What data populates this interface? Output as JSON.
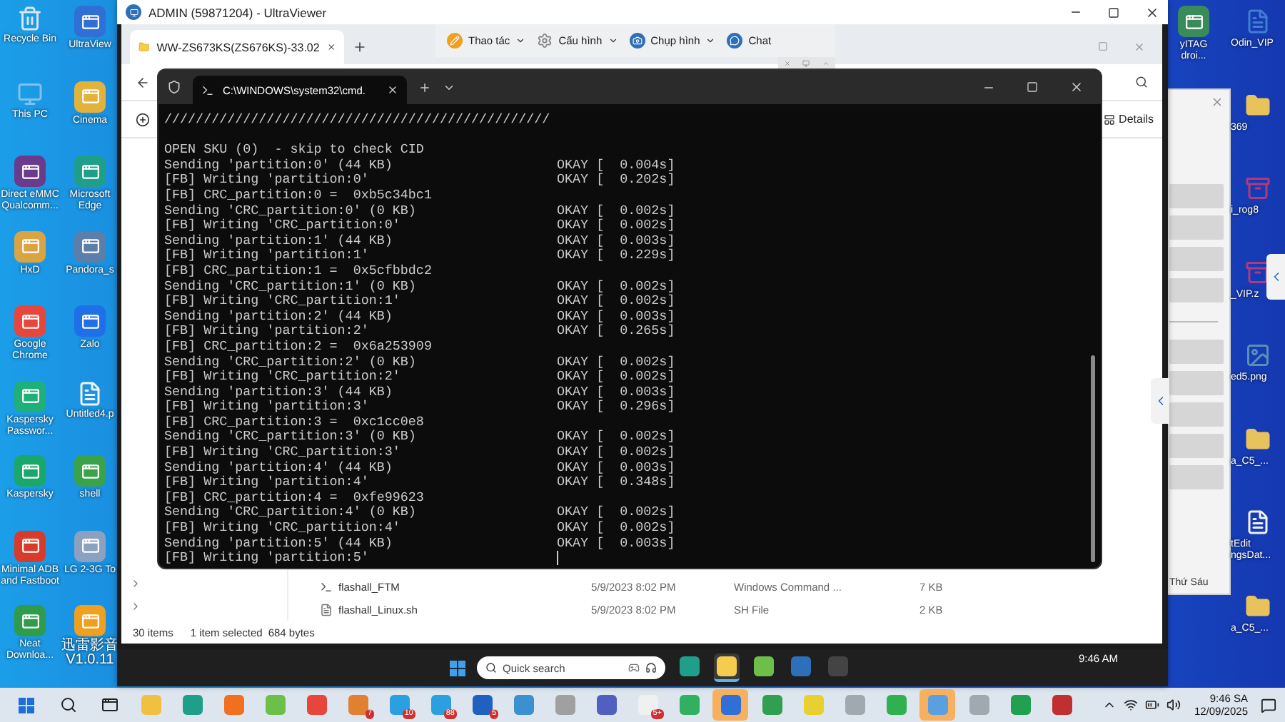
{
  "desktop_left": [
    {
      "label": "Recycle Bin",
      "kind": "recycle",
      "color": "#d8e6f0"
    },
    {
      "label": "UltraView",
      "kind": "app",
      "color": "#2f6fd6"
    },
    {
      "label": "This PC",
      "kind": "computer",
      "color": "#7ec3f0"
    },
    {
      "label": "Cinema",
      "kind": "app",
      "color": "#e2b23a"
    },
    {
      "label": "Direct eMMC Qualcomm...",
      "kind": "app",
      "color": "#6a3b8c"
    },
    {
      "label": "Microsoft Edge",
      "kind": "app",
      "color": "#1f9e8a"
    },
    {
      "label": "HxD",
      "kind": "app",
      "color": "#d9a441"
    },
    {
      "label": "Pandora_s",
      "kind": "app",
      "color": "#5b7fa8"
    },
    {
      "label": "Google Chrome",
      "kind": "app",
      "color": "#e8453c"
    },
    {
      "label": "Zalo",
      "kind": "app",
      "color": "#1e6fe8"
    },
    {
      "label": "Kaspersky Passwor...",
      "kind": "app",
      "color": "#1fb07a"
    },
    {
      "label": "Untitled4.p",
      "kind": "document",
      "color": "#f2f2f2"
    },
    {
      "label": "Kaspersky",
      "kind": "app",
      "color": "#1aa86a"
    },
    {
      "label": "shell",
      "kind": "app",
      "color": "#3aa34a"
    },
    {
      "label": "Minimal ADB and Fastboot",
      "kind": "app",
      "color": "#d93b2b"
    },
    {
      "label": "LG 2-3G To",
      "kind": "app",
      "color": "#8aa1c0"
    },
    {
      "label": "Neat Downloa...",
      "kind": "app",
      "color": "#2e9c4a"
    },
    {
      "label": "迅雷影音 V1.0.11",
      "kind": "app",
      "color": "#f0a020"
    }
  ],
  "desktop_right_partial": {
    "label": "yITAG droi...",
    "kind": "app",
    "color": "#3b8b5a"
  },
  "desktop_right": [
    {
      "label": "Odin_VIP",
      "kind": "document",
      "color": "#3f7fd0"
    },
    {
      "label": "369",
      "kind": "folder",
      "color": "#e8c25a"
    },
    {
      "label": "i_rog8",
      "kind": "archive",
      "color": "#b33a7a"
    },
    {
      "label": "_VIP.z",
      "kind": "archive",
      "color": "#b33a7a"
    },
    {
      "label": "ed5.png",
      "kind": "image",
      "color": "#5a8fb8"
    },
    {
      "label": "a_C5_...",
      "kind": "folder",
      "color": "#e8c25a"
    },
    {
      "label": "tEdit ngsDat...",
      "kind": "document",
      "color": "#f2f2f2"
    },
    {
      "label": "a_C5_...",
      "kind": "folder",
      "color": "#e8c25a"
    }
  ],
  "ultraviewer": {
    "title": "ADMIN (59871204) - UltraViewer",
    "toolbar": [
      {
        "label": "Thao tác",
        "kind": "actions",
        "menu": true
      },
      {
        "label": "Cấu hình",
        "kind": "settings",
        "menu": true
      },
      {
        "label": "Chụp hình",
        "kind": "capture",
        "menu": true
      },
      {
        "label": "Chat",
        "kind": "chat",
        "menu": false
      }
    ]
  },
  "explorer": {
    "tab": "WW-ZS673KS(ZS676KS)-33.02",
    "details_button": "Details",
    "files": [
      {
        "name": "flashall_FTM",
        "date": "5/9/2023 8:02 PM",
        "type": "Windows Command ...",
        "size": "7 KB",
        "kind": "script"
      },
      {
        "name": "flashall_Linux.sh",
        "date": "5/9/2023 8:02 PM",
        "type": "SH File",
        "size": "2 KB",
        "kind": "file"
      }
    ],
    "status": {
      "count": "30 items",
      "selection": "1 item selected",
      "size": "684 bytes"
    }
  },
  "terminal": {
    "tab": "C:\\WINDOWS\\system32\\cmd.",
    "lines": [
      {
        "text": "/////////////////////////////////////////////////"
      },
      {
        "text": "OPEN SKU (0)  - skip to check CID",
        "gap_before": true
      },
      {
        "text": "Sending 'partition:0' (44 KB)",
        "result": "OKAY [  0.004s]"
      },
      {
        "text": "[FB] Writing 'partition:0'",
        "result": "OKAY [  0.202s]"
      },
      {
        "text": "[FB] CRC_partition:0 =  0xb5c34bc1"
      },
      {
        "text": "Sending 'CRC_partition:0' (0 KB)",
        "result": "OKAY [  0.002s]"
      },
      {
        "text": "[FB] Writing 'CRC_partition:0'",
        "result": "OKAY [  0.002s]"
      },
      {
        "text": "Sending 'partition:1' (44 KB)",
        "result": "OKAY [  0.003s]"
      },
      {
        "text": "[FB] Writing 'partition:1'",
        "result": "OKAY [  0.229s]"
      },
      {
        "text": "[FB] CRC_partition:1 =  0x5cfbbdc2"
      },
      {
        "text": "Sending 'CRC_partition:1' (0 KB)",
        "result": "OKAY [  0.002s]"
      },
      {
        "text": "[FB] Writing 'CRC_partition:1'",
        "result": "OKAY [  0.002s]"
      },
      {
        "text": "Sending 'partition:2' (44 KB)",
        "result": "OKAY [  0.003s]"
      },
      {
        "text": "[FB] Writing 'partition:2'",
        "result": "OKAY [  0.265s]"
      },
      {
        "text": "[FB] CRC_partition:2 =  0x6a253909"
      },
      {
        "text": "Sending 'CRC_partition:2' (0 KB)",
        "result": "OKAY [  0.002s]"
      },
      {
        "text": "[FB] Writing 'CRC_partition:2'",
        "result": "OKAY [  0.002s]"
      },
      {
        "text": "Sending 'partition:3' (44 KB)",
        "result": "OKAY [  0.003s]"
      },
      {
        "text": "[FB] Writing 'partition:3'",
        "result": "OKAY [  0.296s]"
      },
      {
        "text": "[FB] CRC_partition:3 =  0xc1cc0e8"
      },
      {
        "text": "Sending 'CRC_partition:3' (0 KB)",
        "result": "OKAY [  0.002s]"
      },
      {
        "text": "[FB] Writing 'CRC_partition:3'",
        "result": "OKAY [  0.002s]"
      },
      {
        "text": "Sending 'partition:4' (44 KB)",
        "result": "OKAY [  0.003s]"
      },
      {
        "text": "[FB] Writing 'partition:4'",
        "result": "OKAY [  0.348s]"
      },
      {
        "text": "[FB] CRC_partition:4 =  0xfe99623"
      },
      {
        "text": "Sending 'CRC_partition:4' (0 KB)",
        "result": "OKAY [  0.002s]"
      },
      {
        "text": "[FB] Writing 'CRC_partition:4'",
        "result": "OKAY [  0.002s]"
      },
      {
        "text": "Sending 'partition:5' (44 KB)",
        "result": "OKAY [  0.003s]"
      },
      {
        "text": "[FB] Writing 'partition:5'",
        "cursor": true
      }
    ]
  },
  "side_panel": {
    "footer": "Thứ Sáu"
  },
  "remote_taskbar": {
    "search_placeholder": "Quick search",
    "time": "9:46 AM",
    "apps": [
      {
        "active": false
      },
      {
        "active": true
      },
      {
        "active": false
      },
      {
        "active": false
      },
      {
        "active": false
      }
    ]
  },
  "taskbar": {
    "time": "9:46 SA",
    "date": "12/09/2025",
    "apps": [
      {
        "active": false
      },
      {
        "active": false
      },
      {
        "active": false
      },
      {
        "active": false
      },
      {
        "active": false
      },
      {
        "active": false,
        "badge": "7"
      },
      {
        "active": false,
        "badge": "10"
      },
      {
        "active": false,
        "badge": "88"
      },
      {
        "active": false,
        "badge": "5"
      },
      {
        "active": false
      },
      {
        "active": false
      },
      {
        "active": false
      },
      {
        "active": false,
        "badge": "5+"
      },
      {
        "active": false
      },
      {
        "active": true
      },
      {
        "active": false
      },
      {
        "active": false
      },
      {
        "active": false
      },
      {
        "active": false
      },
      {
        "active": true
      },
      {
        "active": false
      },
      {
        "active": false
      },
      {
        "active": false
      }
    ]
  }
}
